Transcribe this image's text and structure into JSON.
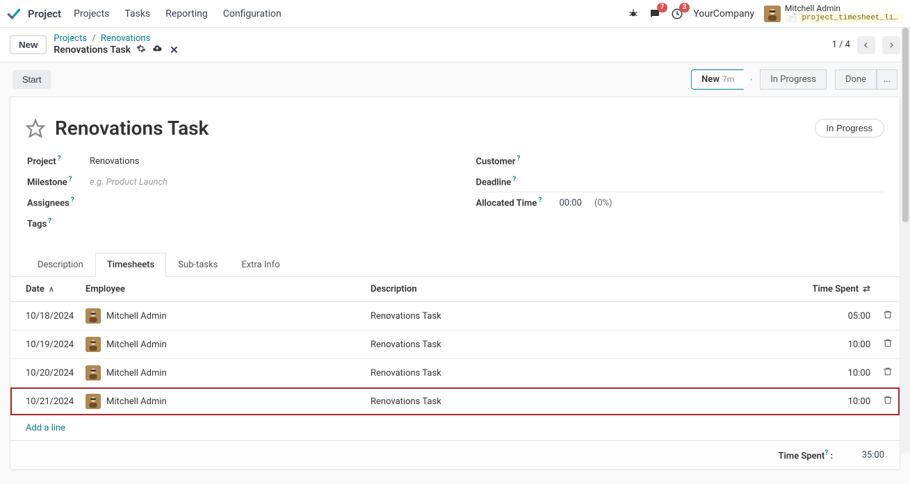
{
  "nav": {
    "app_title": "Project",
    "items": [
      "Projects",
      "Tasks",
      "Reporting",
      "Configuration"
    ],
    "messages_badge": "7",
    "activities_badge": "3",
    "company": "YourCompany",
    "user_name": "Mitchell Admin",
    "database": "project_timesheet_limit_..."
  },
  "header": {
    "new_btn": "New",
    "breadcrumb1": "Projects",
    "breadcrumb2": "Renovations",
    "breadcrumb_current": "Renovations Task",
    "page_counter": "1 / 4"
  },
  "stage_row": {
    "start_btn": "Start",
    "new_label": "New",
    "new_time": "7m",
    "in_progress": "In Progress",
    "done": "Done",
    "dots": "..."
  },
  "task": {
    "title": "Renovations Task",
    "status_pill": "In Progress",
    "labels": {
      "project": "Project",
      "milestone": "Milestone",
      "assignees": "Assignees",
      "tags": "Tags",
      "customer": "Customer",
      "deadline": "Deadline",
      "allocated": "Allocated Time"
    },
    "project_value": "Renovations",
    "milestone_placeholder": "e.g. Product Launch",
    "allocated_time": "00:00",
    "allocated_pct": "(0%)"
  },
  "tabs": [
    "Description",
    "Timesheets",
    "Sub-tasks",
    "Extra Info"
  ],
  "table": {
    "headers": {
      "date": "Date",
      "employee": "Employee",
      "description": "Description",
      "time": "Time Spent"
    },
    "rows": [
      {
        "date": "10/18/2024",
        "employee": "Mitchell Admin",
        "desc": "Renovations Task",
        "time": "05:00"
      },
      {
        "date": "10/19/2024",
        "employee": "Mitchell Admin",
        "desc": "Renovations Task",
        "time": "10:00"
      },
      {
        "date": "10/20/2024",
        "employee": "Mitchell Admin",
        "desc": "Renovations Task",
        "time": "10:00"
      },
      {
        "date": "10/21/2024",
        "employee": "Mitchell Admin",
        "desc": "Renovations Task",
        "time": "10:00"
      }
    ],
    "add_line": "Add a line",
    "footer_label": "Time Spent",
    "footer_total": "35:00"
  }
}
